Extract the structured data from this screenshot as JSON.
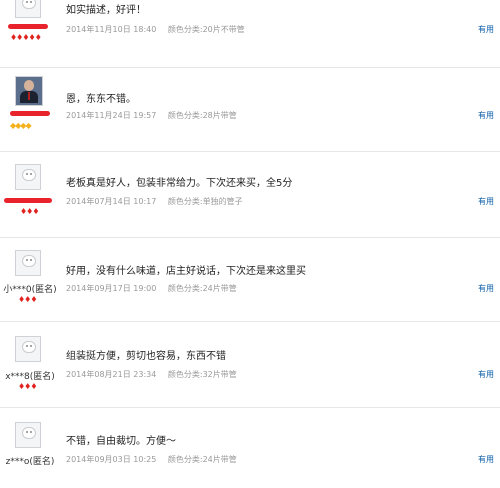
{
  "reviews": [
    {
      "nickname": "",
      "anonymous": false,
      "rank_icons": "♦♦♦♦♦",
      "rank_color": "red",
      "content": "如实描述，好评！",
      "date": "2014年11月10日 18:40",
      "attributes": "颜色分类:20片不带管",
      "useful_label": "有用",
      "avatar": "default-avatar"
    },
    {
      "nickname": "",
      "anonymous": false,
      "rank_icons": "◆◆◆◆",
      "rank_color": "gold",
      "content": "恩，东东不错。",
      "date": "2014年11月24日 19:57",
      "attributes": "颜色分类:28片带管",
      "useful_label": "有用",
      "avatar": "photo-avatar"
    },
    {
      "nickname": "",
      "anonymous": false,
      "rank_icons": "♦♦♦",
      "rank_color": "red",
      "content": "老板真是好人，包装非常给力。下次还来买，全5分",
      "date": "2014年07月14日 10:17",
      "attributes": "颜色分类:单独的管子",
      "useful_label": "有用",
      "avatar": "default-avatar"
    },
    {
      "nickname": "小***0(匿名)",
      "anonymous": true,
      "rank_icons": "♦♦♦",
      "rank_color": "red",
      "content": "好用，没有什么味道，店主好说话，下次还是来这里买",
      "date": "2014年09月17日 19:00",
      "attributes": "颜色分类:24片带管",
      "useful_label": "有用",
      "avatar": "default-avatar"
    },
    {
      "nickname": "x***8(匿名)",
      "anonymous": true,
      "rank_icons": "♦♦♦",
      "rank_color": "red",
      "content": "组装挺方便，剪切也容易，东西不错",
      "date": "2014年08月21日 23:34",
      "attributes": "颜色分类:32片带管",
      "useful_label": "有用",
      "avatar": "default-avatar"
    },
    {
      "nickname": "z***o(匿名)",
      "anonymous": true,
      "rank_icons": "",
      "rank_color": "red",
      "content": "不错，自由裁切。方便～",
      "date": "2014年09月03日 10:25",
      "attributes": "颜色分类:24片带管",
      "useful_label": "有用",
      "avatar": "default-avatar"
    }
  ]
}
